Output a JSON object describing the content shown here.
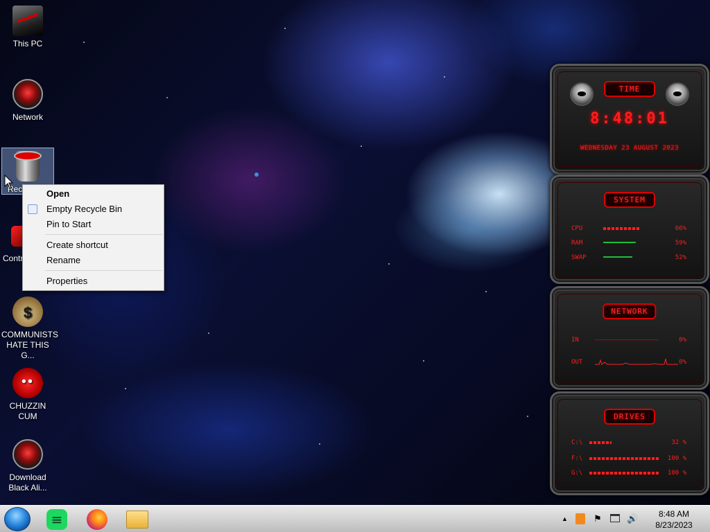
{
  "desktop": {
    "icons": [
      {
        "name": "This PC"
      },
      {
        "name": "Network"
      },
      {
        "name": "Rec"
      },
      {
        "name": "Contr"
      },
      {
        "name": "COMMUNISTS HATE THIS G..."
      },
      {
        "name": "CHUZZIN CUM"
      },
      {
        "name": "Download Black Ali..."
      }
    ]
  },
  "context_menu": {
    "items": [
      "Open",
      "Empty Recycle Bin",
      "Pin to Start",
      "Create shortcut",
      "Rename",
      "Properties"
    ]
  },
  "gadgets": {
    "time": {
      "title": "TIME",
      "clock": "8:48:01",
      "date": "WEDNESDAY 23 AUGUST 2023"
    },
    "system": {
      "title": "SYSTEM",
      "rows": [
        {
          "label": "CPU",
          "value": "66%",
          "fill": 0.66
        },
        {
          "label": "RAM",
          "value": "59%",
          "fill": 0.59
        },
        {
          "label": "SWAP",
          "value": "52%",
          "fill": 0.52
        }
      ]
    },
    "network": {
      "title": "NETWORK",
      "rows": [
        {
          "label": "IN",
          "value": "0%"
        },
        {
          "label": "OUT",
          "value": "0%"
        }
      ]
    },
    "drives": {
      "title": "DRIVES",
      "rows": [
        {
          "label": "C:\\",
          "value": "32 %",
          "fill": 0.32
        },
        {
          "label": "F:\\",
          "value": "100 %",
          "fill": 1.0
        },
        {
          "label": "G:\\",
          "value": "100 %",
          "fill": 1.0
        }
      ]
    }
  },
  "taskbar": {
    "apps": [
      "spotify",
      "firefox",
      "file-explorer"
    ],
    "tray": {
      "time": "8:48 AM",
      "date": "8/23/2023",
      "up_arrow": "▲",
      "flag": "⚑",
      "volume": "🔊"
    }
  },
  "colors": {
    "accent": "#ff1e1e",
    "menu_bg": "#f2f2f2"
  }
}
